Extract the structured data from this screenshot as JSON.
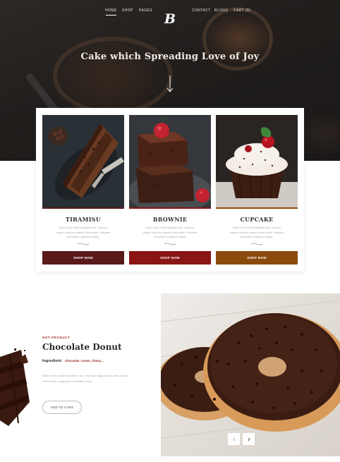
{
  "nav": {
    "left": [
      "HOME",
      "SHOP",
      "PAGES"
    ],
    "right": [
      "CONTACT",
      "BLOGS",
      "CART (0)"
    ],
    "logo": "B"
  },
  "hero": {
    "title": "Cake which Spreading Love of Joy"
  },
  "products": [
    {
      "name": "TIRAMISU",
      "desc": "Nulla Lorem mollit cupidatat irure. Laborum magna nulla duis ullamco cillum dolor. Voluptate exercitation incididunt aliquip.",
      "button": "SHOP NOW",
      "color": "#5a1a1a"
    },
    {
      "name": "BROWNIE",
      "desc": "Nulla Lorem mollit cupidatat irure. Laborum magna nulla duis ullamco cillum dolor. Voluptate exercitation incididunt aliquip.",
      "button": "SHOP NOW",
      "color": "#8a1515"
    },
    {
      "name": "CUPCAKE",
      "desc": "Nulla Lorem mollit cupidatat irure. Laborum magna nulla duis ullamco cillum dolor. Voluptate exercitation incididunt aliquip.",
      "button": "SHOP NOW",
      "color": "#8a4a0c"
    }
  ],
  "feature": {
    "label": "HOT PRODUCT",
    "title": "Chocolate Donut",
    "ingredient_label": "Ingredient:",
    "ingredient_value": "Chocolate, Cream, Cherry....",
    "desc": "Nulla Lorem mollit cupidatat irure. Laborum magna nulla duis ullamco cillum dolor. Voluptate exercitation incid.",
    "button": "ADD TO CART"
  },
  "icons": {
    "hero_arrow": "arrow-down-icon",
    "slider_prev": "chevron-left-icon",
    "slider_next": "chevron-right-icon"
  }
}
